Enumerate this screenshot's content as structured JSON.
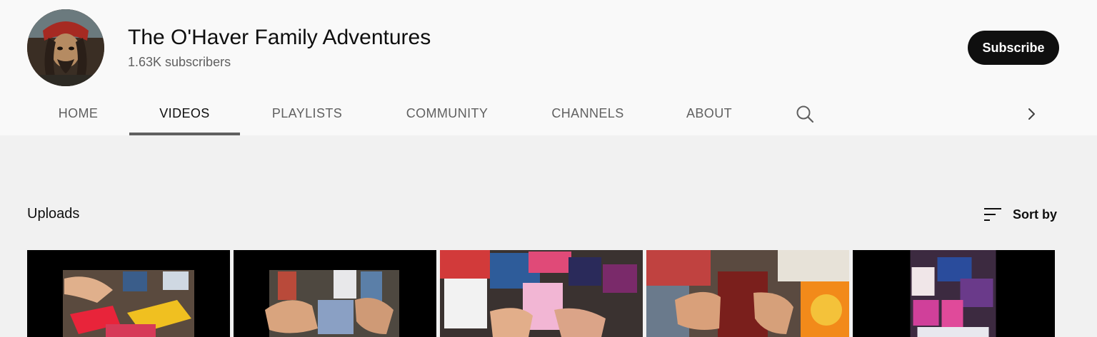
{
  "channel": {
    "name": "The O'Haver Family Adventures",
    "subscribers": "1.63K subscribers",
    "subscribe_label": "Subscribe",
    "avatar_icon": "pirate-avatar"
  },
  "tabs": [
    {
      "label": "HOME",
      "active": false
    },
    {
      "label": "VIDEOS",
      "active": true
    },
    {
      "label": "PLAYLISTS",
      "active": false
    },
    {
      "label": "COMMUNITY",
      "active": false
    },
    {
      "label": "CHANNELS",
      "active": false
    },
    {
      "label": "ABOUT",
      "active": false
    }
  ],
  "icons": {
    "search": "search-icon",
    "next": "chevron-right-icon",
    "sort": "sort-icon"
  },
  "section": {
    "title": "Uploads",
    "sort_label": "Sort by"
  },
  "videos": [
    {
      "thumbnail": "trading-card-pack-thumbnail"
    },
    {
      "thumbnail": "trading-card-pack-thumbnail"
    },
    {
      "thumbnail": "trading-card-pack-thumbnail"
    },
    {
      "thumbnail": "trading-card-pack-thumbnail"
    },
    {
      "thumbnail": "trading-card-pack-thumbnail"
    }
  ],
  "colors": {
    "header_bg": "#f9f9f9",
    "page_bg": "#f1f1f1",
    "text_primary": "#0f0f0f",
    "text_secondary": "#606060",
    "subscribe_bg": "#0f0f0f"
  }
}
